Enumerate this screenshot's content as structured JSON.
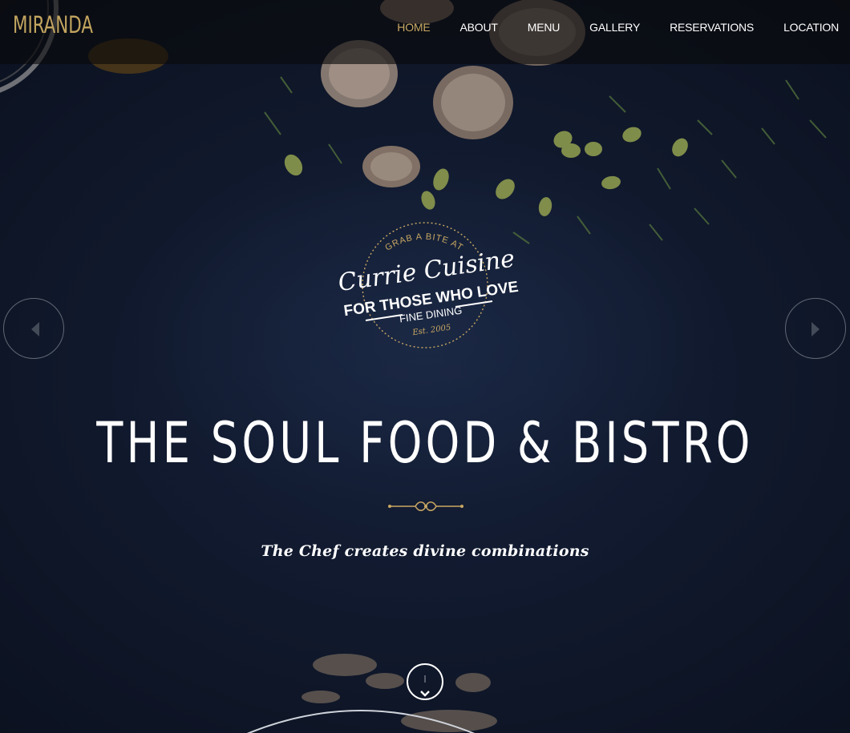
{
  "brand": {
    "name": "MIRANDA"
  },
  "nav": {
    "items": [
      {
        "label": "HOME",
        "active": true
      },
      {
        "label": "ABOUT",
        "active": false
      },
      {
        "label": "MENU",
        "active": false
      },
      {
        "label": "GALLERY",
        "active": false
      },
      {
        "label": "RESERVATIONS",
        "active": false
      },
      {
        "label": "LOCATION",
        "active": false
      }
    ]
  },
  "badge": {
    "top_line": "GRAB A BITE AT",
    "script_line": "Currie Cuisine",
    "line1": "FOR THOSE WHO LOVE",
    "line2": "FINE DINING",
    "est": "Est. 2005"
  },
  "hero": {
    "headline": "THE SOUL FOOD & BISTRO",
    "tagline": "The Chef creates divine combinations"
  },
  "slider": {
    "prev_icon": "chevron-left-icon",
    "next_icon": "chevron-right-icon",
    "scroll_icon": "chevron-down-icon"
  },
  "colors": {
    "accent": "#c9a862",
    "brand": "#c3a55f",
    "background": "#10182a",
    "text": "#ffffff"
  }
}
